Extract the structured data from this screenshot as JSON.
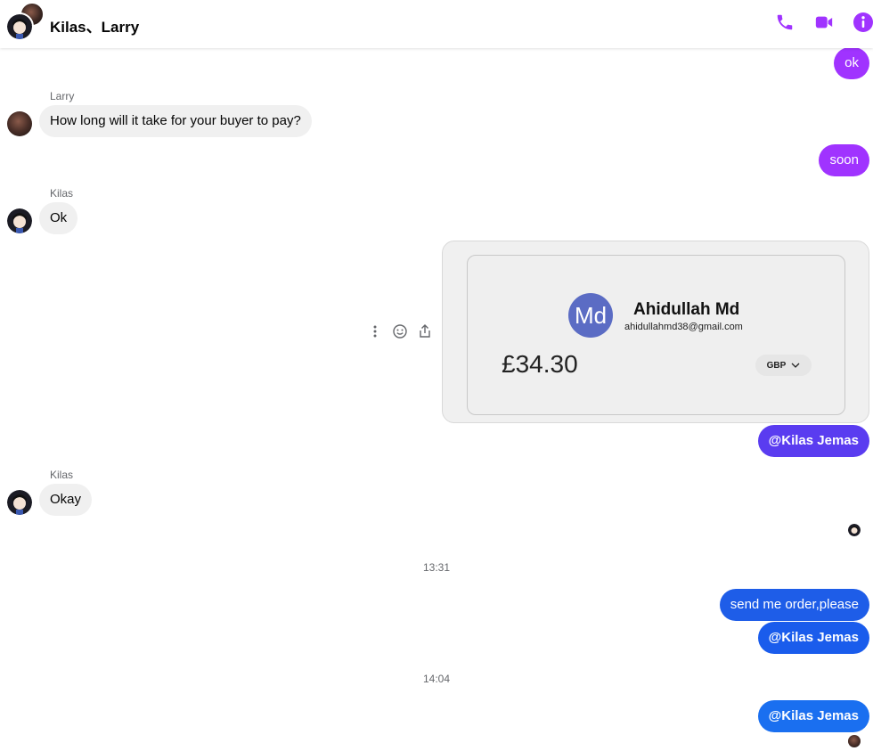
{
  "header": {
    "title": "Kilas、Larry",
    "icons": [
      "phone-icon",
      "video-camera-icon",
      "info-icon"
    ],
    "accent_color": "#a033ff"
  },
  "messages": [
    {
      "side": "out",
      "text": "ok",
      "color": "#a033ff"
    },
    {
      "side": "in",
      "sender": "Larry",
      "text": "How long will it take for your buyer to pay?"
    },
    {
      "side": "out",
      "text": "soon",
      "color": "#a033ff"
    },
    {
      "side": "in",
      "sender": "Kilas",
      "text": "Ok"
    },
    {
      "side": "out",
      "type": "payment-card"
    },
    {
      "side": "out",
      "text": "@Kilas Jemas",
      "color": "#5a3cf0"
    },
    {
      "side": "in",
      "sender": "Kilas",
      "text": "Okay"
    },
    {
      "side": "out",
      "text": "send me order,please",
      "color": "#1e5de8"
    },
    {
      "side": "out",
      "text": "@Kilas Jemas",
      "color": "#1a5cec"
    },
    {
      "side": "out",
      "text": "@Kilas Jemas",
      "color": "#1a6ff0"
    }
  ],
  "payment_card": {
    "initials": "Md",
    "name": "Ahidullah Md",
    "email": "ahidullahmd38@gmail.com",
    "amount": "£34.30",
    "currency": "GBP"
  },
  "timestamps": [
    "13:31",
    "14:04"
  ],
  "message_actions": [
    "more-options-icon",
    "emoji-reaction-icon",
    "share-icon"
  ]
}
